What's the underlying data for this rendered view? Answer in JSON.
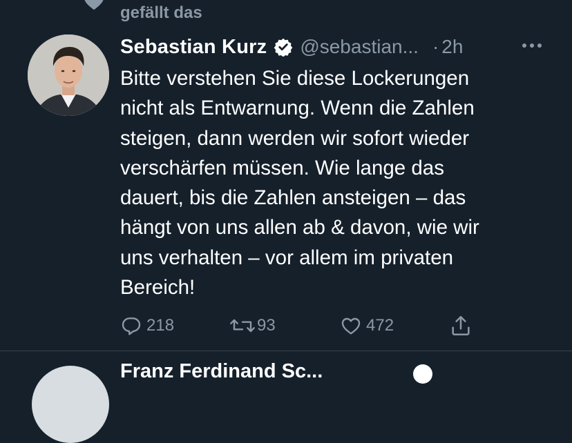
{
  "context": {
    "text": "gefällt das"
  },
  "tweet": {
    "author_name": "Sebastian Kurz",
    "handle": "@sebastian...",
    "separator": "·",
    "time": "2h",
    "text": "Bitte verstehen Sie diese Lockerungen\nnicht als Entwarnung. Wenn die Zahlen\nsteigen, dann werden wir sofort wieder\nverschärfen müssen. Wie lange das\ndauert, bis die Zahlen ansteigen – das\nhängt von uns allen ab & davon, wie wir\nuns verhalten – vor allem im privaten\nBereich!",
    "replies": "218",
    "retweets": "93",
    "likes": "472"
  },
  "next_tweet": {
    "author_name": "Franz Ferdinand Sc..."
  },
  "icons": {
    "context": "heart-icon",
    "verified": "verified-badge-icon",
    "more": "more-icon",
    "reply": "reply-icon",
    "retweet": "retweet-icon",
    "like": "heart-icon",
    "share": "share-icon"
  },
  "colors": {
    "background": "#15202b",
    "primary_text": "#ffffff",
    "secondary_text": "#8b98a5",
    "divider": "#38444d"
  }
}
